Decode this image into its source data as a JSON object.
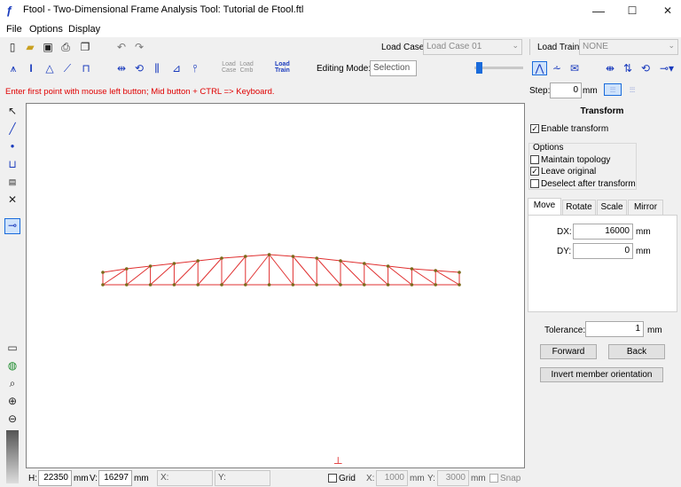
{
  "window": {
    "title": "Ftool - Two-Dimensional Frame Analysis Tool: Tutorial de Ftool.ftl",
    "minimize": "—",
    "maximize": "☐",
    "close": "✕"
  },
  "menu": {
    "file": "File",
    "options": "Options",
    "display": "Display"
  },
  "toolbar": {
    "load_case_label": "Load Case:",
    "load_case_value": "Load Case 01",
    "load_train_label": "Load Train:",
    "load_train_value": "NONE",
    "load_case_btn": "Load Case",
    "load_comb_btn": "Load Cmb",
    "load_train_btn": "Load Train",
    "editing_mode_label": "Editing Mode:",
    "editing_mode_value": "Selection",
    "slider_level": 0.05
  },
  "message": "Enter first point with mouse left button; Mid button + CTRL => Keyboard.",
  "step": {
    "label": "Step:",
    "value": "0",
    "unit": "mm"
  },
  "transform": {
    "title": "Transform",
    "enable_label": "Enable transform",
    "enable_checked": true,
    "options_title": "Options",
    "maintain_topology": "Maintain topology",
    "leave_original": "Leave original",
    "deselect_after": "Deselect after transform",
    "tabs": [
      "Move",
      "Rotate",
      "Scale",
      "Mirror"
    ],
    "dx_label": "DX:",
    "dx_value": "16000",
    "dy_label": "DY:",
    "dy_value": "0",
    "unit": "mm",
    "tolerance_label": "Tolerance:",
    "tolerance_value": "1",
    "forward": "Forward",
    "back": "Back",
    "invert": "Invert member orientation"
  },
  "status": {
    "h_label": "H:",
    "h_value": "22350",
    "h_unit": "mm",
    "v_label": "V:",
    "v_value": "16297",
    "v_unit": "mm",
    "x_label": "X:",
    "y_label": "Y:",
    "grid_label": "Grid",
    "gx_label": "X:",
    "gx_value": "1000",
    "gx_unit": "mm",
    "gy_label": "Y:",
    "gy_value": "3000",
    "gy_unit": "mm",
    "snap_label": "Snap"
  },
  "colors": {
    "member": "#e03030",
    "node": "#7a6a1a",
    "accent": "#1a3bbd"
  }
}
